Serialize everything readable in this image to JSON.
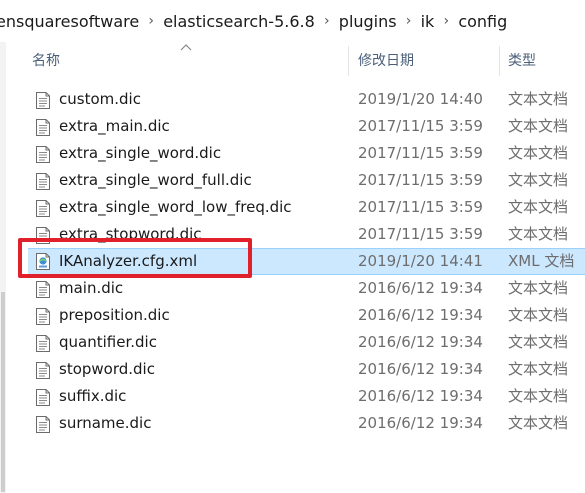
{
  "breadcrumb": [
    "ensquaresoftware",
    "elasticsearch-5.6.8",
    "plugins",
    "ik",
    "config"
  ],
  "breadcrumb_separator": "›",
  "columns": {
    "name": "名称",
    "modified": "修改日期",
    "type": "类型"
  },
  "files": [
    {
      "name": "custom.dic",
      "modified": "2019/1/20 14:40",
      "type": "文本文档",
      "icon": "text-file-icon"
    },
    {
      "name": "extra_main.dic",
      "modified": "2017/11/15 3:59",
      "type": "文本文档",
      "icon": "text-file-icon"
    },
    {
      "name": "extra_single_word.dic",
      "modified": "2017/11/15 3:59",
      "type": "文本文档",
      "icon": "text-file-icon"
    },
    {
      "name": "extra_single_word_full.dic",
      "modified": "2017/11/15 3:59",
      "type": "文本文档",
      "icon": "text-file-icon"
    },
    {
      "name": "extra_single_word_low_freq.dic",
      "modified": "2017/11/15 3:59",
      "type": "文本文档",
      "icon": "text-file-icon"
    },
    {
      "name": "extra_stopword.dic",
      "modified": "2017/11/15 3:59",
      "type": "文本文档",
      "icon": "text-file-icon"
    },
    {
      "name": "IKAnalyzer.cfg.xml",
      "modified": "2019/1/20 14:41",
      "type": "XML 文档",
      "icon": "xml-file-icon",
      "selected": true
    },
    {
      "name": "main.dic",
      "modified": "2016/6/12 19:34",
      "type": "文本文档",
      "icon": "text-file-icon"
    },
    {
      "name": "preposition.dic",
      "modified": "2016/6/12 19:34",
      "type": "文本文档",
      "icon": "text-file-icon"
    },
    {
      "name": "quantifier.dic",
      "modified": "2016/6/12 19:34",
      "type": "文本文档",
      "icon": "text-file-icon"
    },
    {
      "name": "stopword.dic",
      "modified": "2016/6/12 19:34",
      "type": "文本文档",
      "icon": "text-file-icon"
    },
    {
      "name": "suffix.dic",
      "modified": "2016/6/12 19:34",
      "type": "文本文档",
      "icon": "text-file-icon"
    },
    {
      "name": "surname.dic",
      "modified": "2016/6/12 19:34",
      "type": "文本文档",
      "icon": "text-file-icon"
    }
  ],
  "colors": {
    "selection_bg": "#cce8ff",
    "selection_border": "#99d1ff",
    "annotation_box": "#e0202b",
    "header_text": "#4c607a"
  }
}
